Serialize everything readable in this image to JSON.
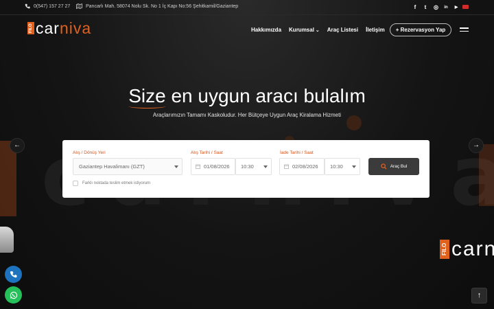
{
  "topbar": {
    "phone": "0(547) 157 27 27",
    "address": "Pancarlı Mah. 58074 Nolu Sk. No 1 İç Kapı No:56 Şehitkamil/Gaziantep",
    "social": [
      {
        "icon": "facebook-icon",
        "glyph": "f"
      },
      {
        "icon": "twitter-icon",
        "glyph": "t"
      },
      {
        "icon": "instagram-icon",
        "glyph": "◎"
      },
      {
        "icon": "linkedin-icon",
        "glyph": "in"
      },
      {
        "icon": "youtube-icon",
        "glyph": "▶"
      }
    ],
    "language_flag": "turkey-flag-icon"
  },
  "logo": {
    "filo": "FILO",
    "part1": "car",
    "part2": "niva"
  },
  "nav": {
    "items": [
      "Hakkımızda",
      "Kurumsal",
      "Araç Listesi",
      "İletişim"
    ],
    "cta": "+ Rezervasyon Yap"
  },
  "hero": {
    "title_accent": "Size",
    "title_rest": " en uygun aracı bulalım",
    "subtitle": "Araçlarımızın Tamamı Kaskoludur. Her Bütçeye Uygun Araç Kiralama Hizmeti"
  },
  "form": {
    "location_label": "Alış / Dönüş Yeri",
    "location_value": "Gaziantep Havalimanı (GZT)",
    "pickup_label": "Alış Tarihi / Saat",
    "pickup_date": "01/08/2026",
    "pickup_time": "10:30",
    "return_label": "İade Tarihi / Saat",
    "return_date": "02/08/2026",
    "return_time": "10:30",
    "search_label": "Araç Bul",
    "different_location_label": "Farklı noktada teslim etmek istiyorum"
  },
  "watermark": {
    "text": "carniva",
    "filo": "FILO"
  },
  "colors": {
    "accent": "#e0601e",
    "background": "#121212",
    "button": "#3b3b3b"
  }
}
